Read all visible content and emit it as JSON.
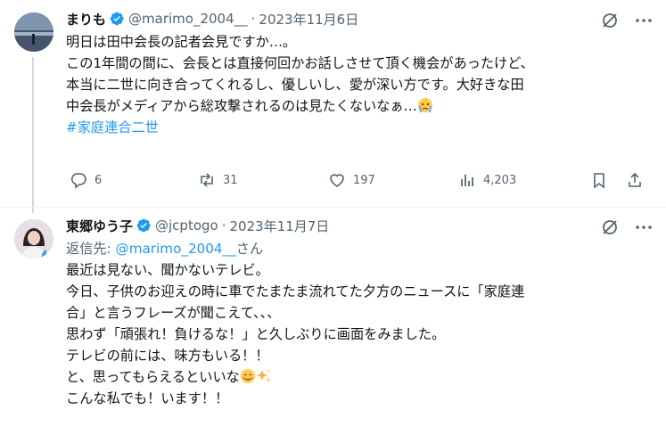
{
  "tweet1": {
    "name": "まりも",
    "handle": "@marimo_2004__",
    "date": "2023年11月6日",
    "lines": [
      "明日は田中会長の記者会見ですか…。",
      "この1年間の間に、会長とは直接何回かお話しさせて頂く機会があったけど、",
      "本当に二世に向き合ってくれるし、優しいし、愛が深い方です。大好きな田",
      "中会長がメディアから総攻撃されるのは見たくないなぁ…"
    ],
    "emoji_1": "crying-face-emoji",
    "hashtag": "#家庭連合二世",
    "replies": "6",
    "reposts": "31",
    "likes": "197",
    "views": "4,203"
  },
  "tweet2": {
    "name": "東郷ゆう子",
    "handle": "@jcptogo",
    "date": "2023年11月7日",
    "reply_label": "返信先: ",
    "reply_mention": "@marimo_2004__",
    "reply_suffix": "さん",
    "lines": [
      "最近は見ない、聞かないテレビ。",
      "今日、子供のお迎えの時に車でたまたま流れてた夕方のニュースに「家庭連",
      "合」と言うフレーズが聞こえて、、、",
      "思わず「頑張れ！負けるな！」と久しぶりに画面をみました。",
      "テレビの前には、味方もいる！！",
      "と、思ってもらえるといいな",
      "こんな私でも！います！！"
    ],
    "emoji_2": "smiling-face-emoji",
    "emoji_3": "sparkles-emoji"
  },
  "colors": {
    "accent": "#1d9bf0",
    "muted": "#536471",
    "text": "#0f1419"
  }
}
